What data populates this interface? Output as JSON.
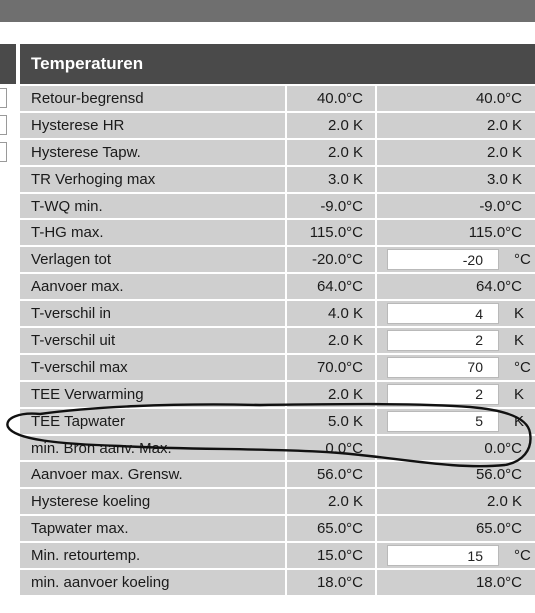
{
  "panel": {
    "title": "Temperaturen",
    "rows": [
      {
        "label": "Retour-begrensd",
        "value": "40.0°C",
        "setting": "40.0°C",
        "input": false
      },
      {
        "label": "Hysterese HR",
        "value": "2.0 K",
        "setting": "2.0 K",
        "input": false
      },
      {
        "label": "Hysterese Tapw.",
        "value": "2.0 K",
        "setting": "2.0 K",
        "input": false
      },
      {
        "label": "TR Verhoging max",
        "value": "3.0 K",
        "setting": "3.0 K",
        "input": false
      },
      {
        "label": "T-WQ min.",
        "value": "-9.0°C",
        "setting": "-9.0°C",
        "input": false
      },
      {
        "label": "T-HG max.",
        "value": "115.0°C",
        "setting": "115.0°C",
        "input": false
      },
      {
        "label": "Verlagen tot",
        "value": "-20.0°C",
        "setting": "-20",
        "unit": "°C",
        "input": true
      },
      {
        "label": "Aanvoer max.",
        "value": "64.0°C",
        "setting": "64.0°C",
        "input": false
      },
      {
        "label": "T-verschil in",
        "value": "4.0 K",
        "setting": "4",
        "unit": "K",
        "input": true
      },
      {
        "label": "T-verschil uit",
        "value": "2.0 K",
        "setting": "2",
        "unit": "K",
        "input": true
      },
      {
        "label": "T-verschil max",
        "value": "70.0°C",
        "setting": "70",
        "unit": "°C",
        "input": true
      },
      {
        "label": "TEE Verwarming",
        "value": "2.0 K",
        "setting": "2",
        "unit": "K",
        "input": true
      },
      {
        "label": "TEE Tapwater",
        "value": "5.0 K",
        "setting": "5",
        "unit": "K",
        "input": true
      },
      {
        "label": "min. Bron aanv. Max.",
        "value": "0.0°C",
        "setting": "0.0°C",
        "input": false
      },
      {
        "label": "Aanvoer max. Grensw.",
        "value": "56.0°C",
        "setting": "56.0°C",
        "input": false
      },
      {
        "label": "Hysterese koeling",
        "value": "2.0 K",
        "setting": "2.0 K",
        "input": false
      },
      {
        "label": "Tapwater max.",
        "value": "65.0°C",
        "setting": "65.0°C",
        "input": false
      },
      {
        "label": "Min. retourtemp.",
        "value": "15.0°C",
        "setting": "15",
        "unit": "°C",
        "input": true
      },
      {
        "label": "min. aanvoer koeling",
        "value": "18.0°C",
        "setting": "18.0°C",
        "input": false
      }
    ]
  }
}
